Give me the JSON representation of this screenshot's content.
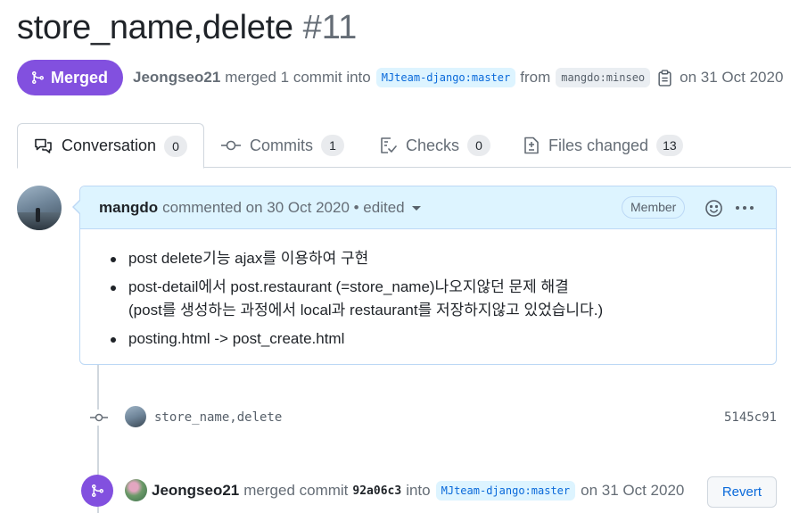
{
  "title": {
    "text": "store_name,delete",
    "number": "#11"
  },
  "meta": {
    "state": "Merged",
    "author": "Jeongseo21",
    "merged_text": "merged 1 commit into",
    "base_branch": "MJteam-django:master",
    "from_text": "from",
    "head_branch": "mangdo:minseo",
    "date_text": "on 31 Oct 2020",
    "accent_color": "#8250df"
  },
  "tabs": [
    {
      "label": "Conversation",
      "count": "0",
      "icon": "comment-discussion-icon",
      "selected": true
    },
    {
      "label": "Commits",
      "count": "1",
      "icon": "git-commit-icon",
      "selected": false
    },
    {
      "label": "Checks",
      "count": "0",
      "icon": "checklist-icon",
      "selected": false
    },
    {
      "label": "Files changed",
      "count": "13",
      "icon": "file-diff-icon",
      "selected": false
    }
  ],
  "comment": {
    "author": "mangdo",
    "text": "commented on 30 Oct 2020 • edited",
    "role_badge": "Member",
    "items": [
      [
        "post delete기능 ajax를 이용하여 구현"
      ],
      [
        "post-detail에서 post.restaurant (=store_name)나오지않던 문제 해결",
        "(post를 생성하는 과정에서 local과 restaurant를 저장하지않고 있었습니다.)"
      ],
      [
        "posting.html -> post_create.html"
      ]
    ]
  },
  "commit": {
    "message": "store_name,delete",
    "sha": "5145c91"
  },
  "merge_event": {
    "author": "Jeongseo21",
    "text": "merged commit",
    "sha": "92a06c3",
    "into_text": "into",
    "branch": "MJteam-django:master",
    "date_text": "on 31 Oct 2020",
    "revert_label": "Revert"
  }
}
